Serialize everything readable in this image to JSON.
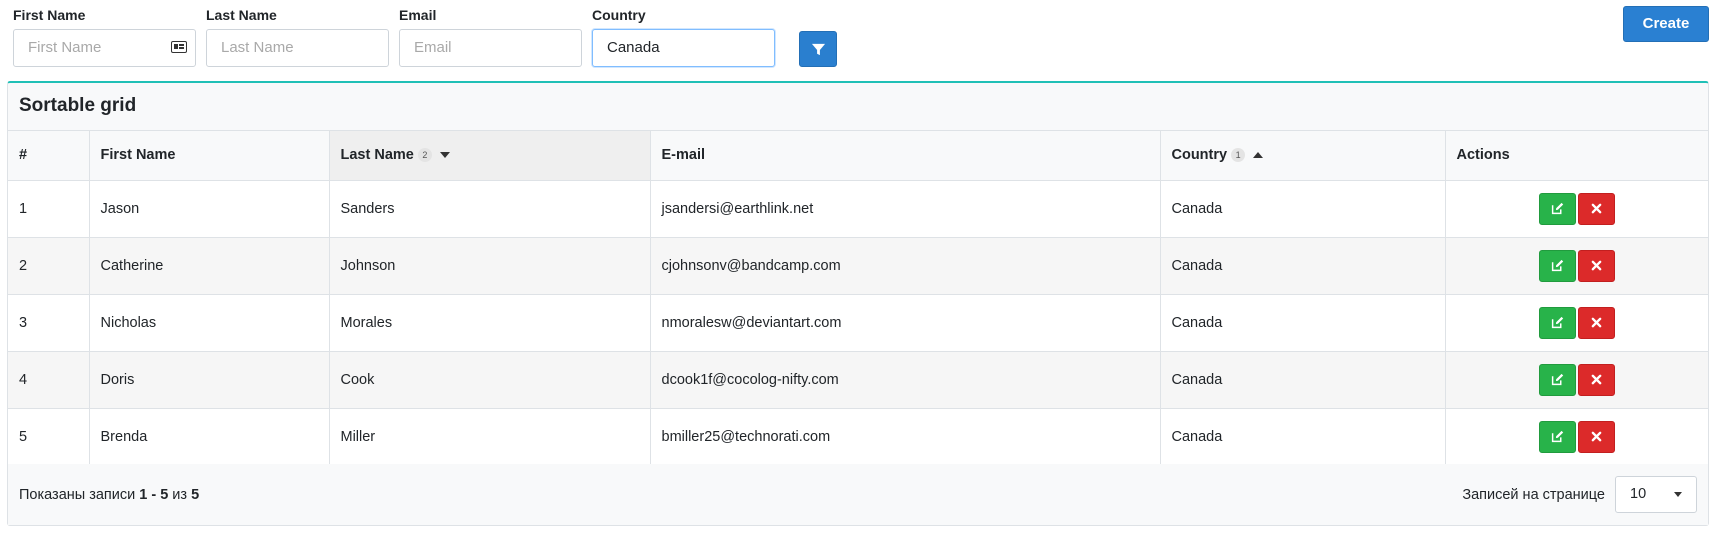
{
  "filters": [
    {
      "label": "First Name",
      "value": "",
      "placeholder": "First Name",
      "icon": "contact-card-icon"
    },
    {
      "label": "Last Name",
      "value": "",
      "placeholder": "Last Name"
    },
    {
      "label": "Email",
      "value": "",
      "placeholder": "Email"
    },
    {
      "label": "Country",
      "value": "Canada",
      "placeholder": ""
    }
  ],
  "filter_button": {
    "icon": "filter-icon"
  },
  "create_button": {
    "label": "Create"
  },
  "grid": {
    "title": "Sortable grid",
    "columns": [
      {
        "label": "#"
      },
      {
        "label": "First Name"
      },
      {
        "label": "Last Name",
        "sort_order": "2",
        "sort_dir": "desc"
      },
      {
        "label": "E-mail"
      },
      {
        "label": "Country",
        "sort_order": "1",
        "sort_dir": "asc"
      },
      {
        "label": "Actions"
      }
    ],
    "rows": [
      {
        "num": "1",
        "first": "Jason",
        "last": "Sanders",
        "email": "jsandersi@earthlink.net",
        "country": "Canada"
      },
      {
        "num": "2",
        "first": "Catherine",
        "last": "Johnson",
        "email": "cjohnsonv@bandcamp.com",
        "country": "Canada"
      },
      {
        "num": "3",
        "first": "Nicholas",
        "last": "Morales",
        "email": "nmoralesw@deviantart.com",
        "country": "Canada"
      },
      {
        "num": "4",
        "first": "Doris",
        "last": "Cook",
        "email": "dcook1f@cocolog-nifty.com",
        "country": "Canada"
      },
      {
        "num": "5",
        "first": "Brenda",
        "last": "Miller",
        "email": "bmiller25@technorati.com",
        "country": "Canada"
      }
    ]
  },
  "footer": {
    "shown_prefix": "Показаны записи ",
    "shown_range": "1 - 5",
    "shown_of": " из ",
    "shown_total": "5",
    "per_page_label": "Записей на странице",
    "per_page_value": "10"
  },
  "colors": {
    "primary": "#2a80d2",
    "success": "#28b34a",
    "danger": "#dc2a2a",
    "accent_border": "#20c0b6"
  }
}
